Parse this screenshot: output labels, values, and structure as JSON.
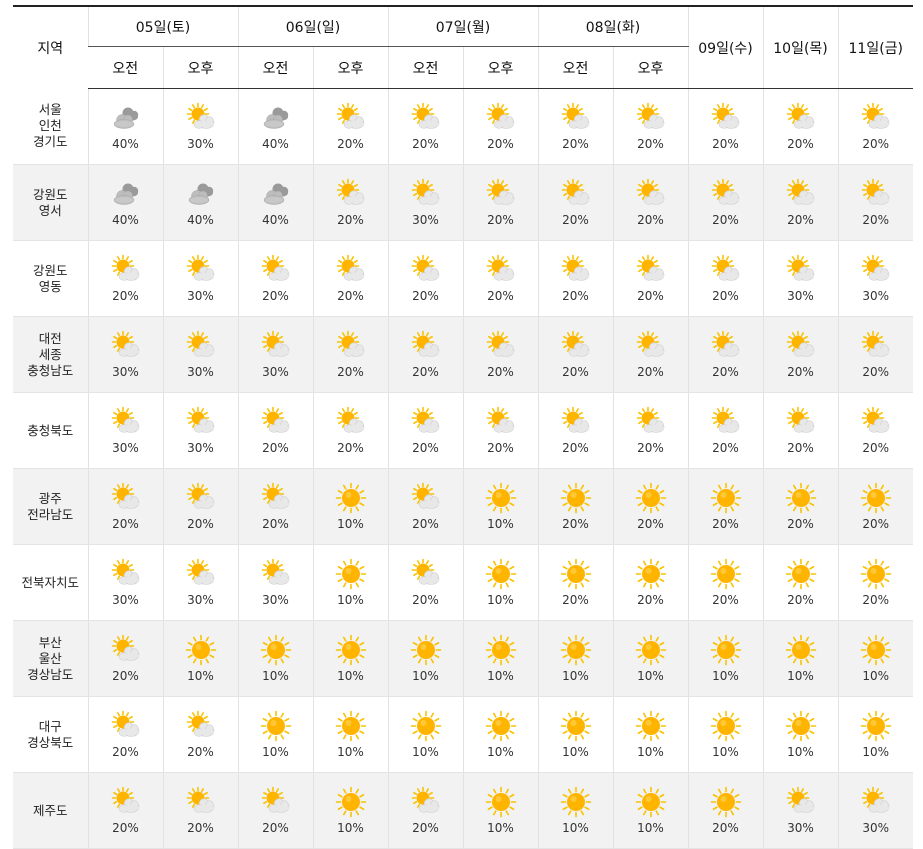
{
  "header": {
    "region_label": "지역",
    "day_groups": [
      "05일(토)",
      "06일(일)",
      "07일(월)",
      "08일(화)"
    ],
    "ampm_labels": [
      "오전",
      "오후",
      "오전",
      "오후",
      "오전",
      "오후",
      "오전",
      "오후"
    ],
    "single_days": [
      "09일(수)",
      "10일(목)",
      "11일(금)"
    ]
  },
  "rows": [
    {
      "region": [
        "서울",
        "인천",
        "경기도"
      ],
      "cells": [
        {
          "icon": "cloudy-icon",
          "pct": "40%"
        },
        {
          "icon": "partly-sunny-icon",
          "pct": "30%"
        },
        {
          "icon": "cloudy-icon",
          "pct": "40%"
        },
        {
          "icon": "partly-sunny-icon",
          "pct": "20%"
        },
        {
          "icon": "partly-sunny-icon",
          "pct": "20%"
        },
        {
          "icon": "partly-sunny-icon",
          "pct": "20%"
        },
        {
          "icon": "partly-sunny-icon",
          "pct": "20%"
        },
        {
          "icon": "partly-sunny-icon",
          "pct": "20%"
        },
        {
          "icon": "partly-sunny-icon",
          "pct": "20%"
        },
        {
          "icon": "partly-sunny-icon",
          "pct": "20%"
        },
        {
          "icon": "partly-sunny-icon",
          "pct": "20%"
        }
      ]
    },
    {
      "region": [
        "강원도",
        "영서"
      ],
      "cells": [
        {
          "icon": "cloudy-icon",
          "pct": "40%"
        },
        {
          "icon": "cloudy-icon",
          "pct": "40%"
        },
        {
          "icon": "cloudy-icon",
          "pct": "40%"
        },
        {
          "icon": "partly-sunny-icon",
          "pct": "20%"
        },
        {
          "icon": "partly-sunny-icon",
          "pct": "30%"
        },
        {
          "icon": "partly-sunny-icon",
          "pct": "20%"
        },
        {
          "icon": "partly-sunny-icon",
          "pct": "20%"
        },
        {
          "icon": "partly-sunny-icon",
          "pct": "20%"
        },
        {
          "icon": "partly-sunny-icon",
          "pct": "20%"
        },
        {
          "icon": "partly-sunny-icon",
          "pct": "20%"
        },
        {
          "icon": "partly-sunny-icon",
          "pct": "20%"
        }
      ]
    },
    {
      "region": [
        "강원도",
        "영동"
      ],
      "cells": [
        {
          "icon": "partly-sunny-icon",
          "pct": "20%"
        },
        {
          "icon": "partly-sunny-icon",
          "pct": "30%"
        },
        {
          "icon": "partly-sunny-icon",
          "pct": "20%"
        },
        {
          "icon": "partly-sunny-icon",
          "pct": "20%"
        },
        {
          "icon": "partly-sunny-icon",
          "pct": "20%"
        },
        {
          "icon": "partly-sunny-icon",
          "pct": "20%"
        },
        {
          "icon": "partly-sunny-icon",
          "pct": "20%"
        },
        {
          "icon": "partly-sunny-icon",
          "pct": "20%"
        },
        {
          "icon": "partly-sunny-icon",
          "pct": "20%"
        },
        {
          "icon": "partly-sunny-icon",
          "pct": "30%"
        },
        {
          "icon": "partly-sunny-icon",
          "pct": "30%"
        }
      ]
    },
    {
      "region": [
        "대전",
        "세종",
        "충청남도"
      ],
      "cells": [
        {
          "icon": "partly-sunny-icon",
          "pct": "30%"
        },
        {
          "icon": "partly-sunny-icon",
          "pct": "30%"
        },
        {
          "icon": "partly-sunny-icon",
          "pct": "30%"
        },
        {
          "icon": "partly-sunny-icon",
          "pct": "20%"
        },
        {
          "icon": "partly-sunny-icon",
          "pct": "20%"
        },
        {
          "icon": "partly-sunny-icon",
          "pct": "20%"
        },
        {
          "icon": "partly-sunny-icon",
          "pct": "20%"
        },
        {
          "icon": "partly-sunny-icon",
          "pct": "20%"
        },
        {
          "icon": "partly-sunny-icon",
          "pct": "20%"
        },
        {
          "icon": "partly-sunny-icon",
          "pct": "20%"
        },
        {
          "icon": "partly-sunny-icon",
          "pct": "20%"
        }
      ]
    },
    {
      "region": [
        "충청북도"
      ],
      "cells": [
        {
          "icon": "partly-sunny-icon",
          "pct": "30%"
        },
        {
          "icon": "partly-sunny-icon",
          "pct": "30%"
        },
        {
          "icon": "partly-sunny-icon",
          "pct": "20%"
        },
        {
          "icon": "partly-sunny-icon",
          "pct": "20%"
        },
        {
          "icon": "partly-sunny-icon",
          "pct": "20%"
        },
        {
          "icon": "partly-sunny-icon",
          "pct": "20%"
        },
        {
          "icon": "partly-sunny-icon",
          "pct": "20%"
        },
        {
          "icon": "partly-sunny-icon",
          "pct": "20%"
        },
        {
          "icon": "partly-sunny-icon",
          "pct": "20%"
        },
        {
          "icon": "partly-sunny-icon",
          "pct": "20%"
        },
        {
          "icon": "partly-sunny-icon",
          "pct": "20%"
        }
      ]
    },
    {
      "region": [
        "광주",
        "전라남도"
      ],
      "cells": [
        {
          "icon": "partly-sunny-icon",
          "pct": "20%"
        },
        {
          "icon": "partly-sunny-icon",
          "pct": "20%"
        },
        {
          "icon": "partly-sunny-icon",
          "pct": "20%"
        },
        {
          "icon": "sunny-icon",
          "pct": "10%"
        },
        {
          "icon": "partly-sunny-icon",
          "pct": "20%"
        },
        {
          "icon": "sunny-icon",
          "pct": "10%"
        },
        {
          "icon": "sunny-icon",
          "pct": "20%"
        },
        {
          "icon": "sunny-icon",
          "pct": "20%"
        },
        {
          "icon": "sunny-icon",
          "pct": "20%"
        },
        {
          "icon": "sunny-icon",
          "pct": "20%"
        },
        {
          "icon": "sunny-icon",
          "pct": "20%"
        }
      ]
    },
    {
      "region": [
        "전북자치도"
      ],
      "cells": [
        {
          "icon": "partly-sunny-icon",
          "pct": "30%"
        },
        {
          "icon": "partly-sunny-icon",
          "pct": "30%"
        },
        {
          "icon": "partly-sunny-icon",
          "pct": "30%"
        },
        {
          "icon": "sunny-icon",
          "pct": "10%"
        },
        {
          "icon": "partly-sunny-icon",
          "pct": "20%"
        },
        {
          "icon": "sunny-icon",
          "pct": "10%"
        },
        {
          "icon": "sunny-icon",
          "pct": "20%"
        },
        {
          "icon": "sunny-icon",
          "pct": "20%"
        },
        {
          "icon": "sunny-icon",
          "pct": "20%"
        },
        {
          "icon": "sunny-icon",
          "pct": "20%"
        },
        {
          "icon": "sunny-icon",
          "pct": "20%"
        }
      ]
    },
    {
      "region": [
        "부산",
        "울산",
        "경상남도"
      ],
      "cells": [
        {
          "icon": "partly-sunny-icon",
          "pct": "20%"
        },
        {
          "icon": "sunny-icon",
          "pct": "10%"
        },
        {
          "icon": "sunny-icon",
          "pct": "10%"
        },
        {
          "icon": "sunny-icon",
          "pct": "10%"
        },
        {
          "icon": "sunny-icon",
          "pct": "10%"
        },
        {
          "icon": "sunny-icon",
          "pct": "10%"
        },
        {
          "icon": "sunny-icon",
          "pct": "10%"
        },
        {
          "icon": "sunny-icon",
          "pct": "10%"
        },
        {
          "icon": "sunny-icon",
          "pct": "10%"
        },
        {
          "icon": "sunny-icon",
          "pct": "10%"
        },
        {
          "icon": "sunny-icon",
          "pct": "10%"
        }
      ]
    },
    {
      "region": [
        "대구",
        "경상북도"
      ],
      "cells": [
        {
          "icon": "partly-sunny-icon",
          "pct": "20%"
        },
        {
          "icon": "partly-sunny-icon",
          "pct": "20%"
        },
        {
          "icon": "sunny-icon",
          "pct": "10%"
        },
        {
          "icon": "sunny-icon",
          "pct": "10%"
        },
        {
          "icon": "sunny-icon",
          "pct": "10%"
        },
        {
          "icon": "sunny-icon",
          "pct": "10%"
        },
        {
          "icon": "sunny-icon",
          "pct": "10%"
        },
        {
          "icon": "sunny-icon",
          "pct": "10%"
        },
        {
          "icon": "sunny-icon",
          "pct": "10%"
        },
        {
          "icon": "sunny-icon",
          "pct": "10%"
        },
        {
          "icon": "sunny-icon",
          "pct": "10%"
        }
      ]
    },
    {
      "region": [
        "제주도"
      ],
      "cells": [
        {
          "icon": "partly-sunny-icon",
          "pct": "20%"
        },
        {
          "icon": "partly-sunny-icon",
          "pct": "20%"
        },
        {
          "icon": "partly-sunny-icon",
          "pct": "20%"
        },
        {
          "icon": "sunny-icon",
          "pct": "10%"
        },
        {
          "icon": "partly-sunny-icon",
          "pct": "20%"
        },
        {
          "icon": "sunny-icon",
          "pct": "10%"
        },
        {
          "icon": "sunny-icon",
          "pct": "10%"
        },
        {
          "icon": "sunny-icon",
          "pct": "10%"
        },
        {
          "icon": "sunny-icon",
          "pct": "20%"
        },
        {
          "icon": "partly-sunny-icon",
          "pct": "30%"
        },
        {
          "icon": "partly-sunny-icon",
          "pct": "30%"
        }
      ]
    }
  ],
  "colors": {
    "sun": "#FFB400",
    "sun_ray": "#F7C300",
    "cloud": "#E8E8E8",
    "dark_cloud": "#9A9A9A",
    "row_alt_bg": "#F2F2F2",
    "header_rule": "#222222"
  }
}
